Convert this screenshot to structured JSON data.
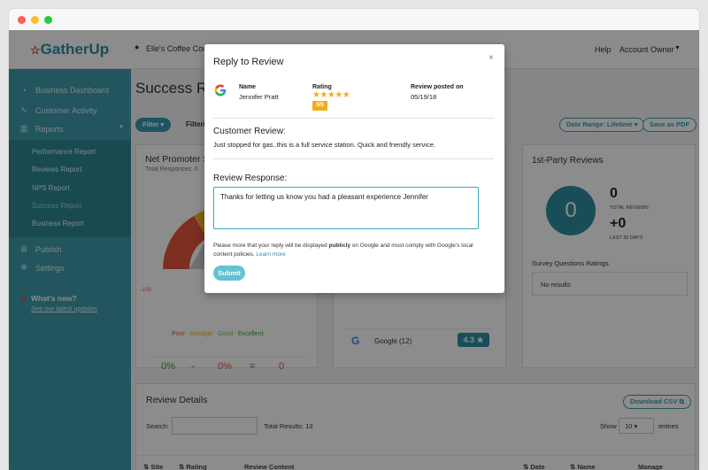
{
  "brand": {
    "name_a": "Gather",
    "name_b": "Up"
  },
  "location": "Elle's Coffee Corne",
  "top_links": {
    "help": "Help",
    "account": "Account Owner"
  },
  "sidebar": {
    "items": [
      {
        "label": "Business Dashboard",
        "icon": "speedometer-icon"
      },
      {
        "label": "Customer Activity",
        "icon": "activity-icon"
      },
      {
        "label": "Reports",
        "icon": "bar-chart-icon"
      },
      {
        "label": "Publish",
        "icon": "publish-icon"
      },
      {
        "label": "Settings",
        "icon": "gear-icon"
      }
    ],
    "submenu": [
      "Performance Report",
      "Reviews Report",
      "NPS Report",
      "Success Report",
      "Business Report"
    ],
    "whats_new": "What's new?",
    "updates_link": "See our latest updates"
  },
  "main": {
    "page_title": "Success Re",
    "filter_label": "Filter",
    "filter_text": "Filteri",
    "date_range": "Date Range: Lifetime",
    "save_pdf": "Save as PDF"
  },
  "nps": {
    "title": "Net Promoter S",
    "total": "Total Responses: 0",
    "scale_min": "-100",
    "scale_mark": "0",
    "legend": [
      "Poor",
      "Average",
      "Good",
      "Excellent"
    ],
    "stats": [
      {
        "value": "0%",
        "label": "Promoters"
      },
      {
        "value": "0%",
        "label": "Detractors"
      },
      {
        "value": "0",
        "label": "NPS Score"
      }
    ],
    "minus": "-",
    "equals": "="
  },
  "sites": {
    "google_label": "Google (12)",
    "google_rating": "4.3"
  },
  "first_party": {
    "title": "1st-Party Reviews",
    "circle_value": "0",
    "total_value": "0",
    "total_label": "TOTAL REVIEWS",
    "recent_value": "+0",
    "recent_label": "LAST 30 DAYS",
    "survey_label": "Survey Questions Ratings",
    "no_results": "No results"
  },
  "review_details": {
    "title": "Review Details",
    "download": "Download CSV",
    "search_label": "Search:",
    "total_results": "Total Results: 13",
    "show_label": "Show",
    "show_value": "10",
    "entries_label": "entries",
    "columns": [
      "Site",
      "Rating",
      "Review Content",
      "Date",
      "Name",
      "Manage"
    ]
  },
  "modal": {
    "title": "Reply to Review",
    "close": "×",
    "name_label": "Name",
    "name_value": "Jennifer Pratt",
    "rating_label": "Rating",
    "rating_stars": "★★★★★",
    "rating_badge": "5/5",
    "posted_label": "Review posted on",
    "posted_value": "05/19/18",
    "customer_review_title": "Customer Review:",
    "customer_review_text": "Just stopped for gas..this is a full service station. Quick and friendly service.",
    "response_title": "Review Response:",
    "response_value": "Thanks for letting us know you had a pleasant experience Jennifer",
    "notice_a": "Please more that your reply will be displayed ",
    "notice_bold": "publicly",
    "notice_b": " on Google and must comply with Google's local content policies. ",
    "notice_link": "Learn more",
    "submit": "Submit"
  },
  "colors": {
    "teal": "#3e9cab",
    "accent": "#3aa7bd",
    "star": "#f0ad1e",
    "brand_red": "#e6425e"
  }
}
